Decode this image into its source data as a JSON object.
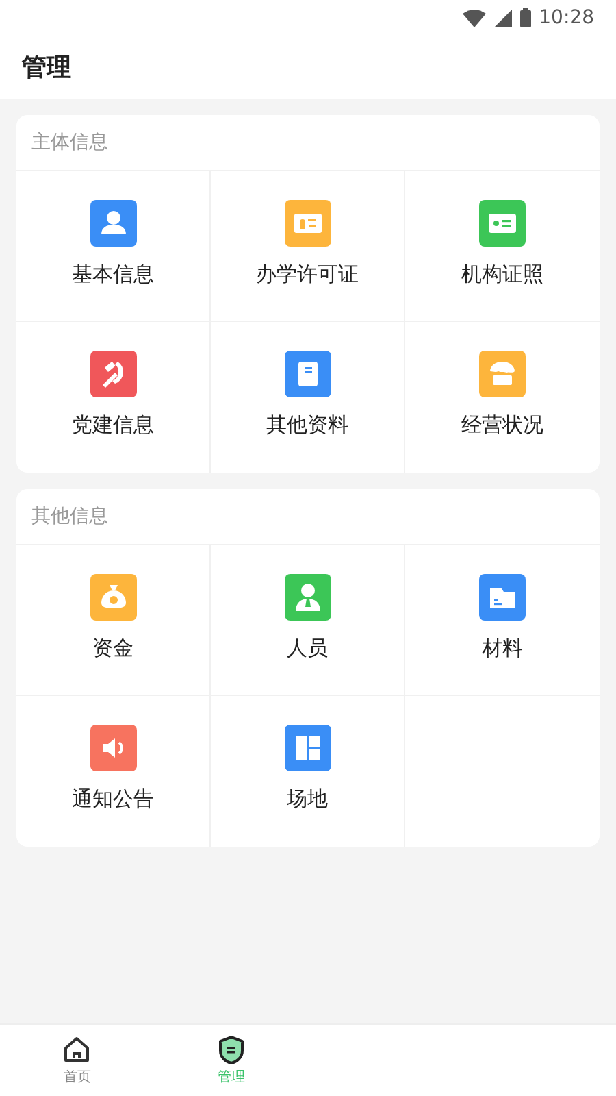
{
  "status_bar": {
    "time": "10:28"
  },
  "header": {
    "title": "管理"
  },
  "sections": [
    {
      "title": "主体信息",
      "items": [
        {
          "label": "基本信息",
          "kind": "person",
          "color": "#3a8ef6"
        },
        {
          "label": "办学许可证",
          "kind": "license",
          "color": "#fdb53c"
        },
        {
          "label": "机构证照",
          "kind": "idcard",
          "color": "#3cc657"
        },
        {
          "label": "党建信息",
          "kind": "emblem",
          "color": "#f0575a"
        },
        {
          "label": "其他资料",
          "kind": "document",
          "color": "#3a8ef6"
        },
        {
          "label": "经营状况",
          "kind": "shop",
          "color": "#fdb53c"
        }
      ]
    },
    {
      "title": "其他信息",
      "items": [
        {
          "label": "资金",
          "kind": "moneybag",
          "color": "#fdb53c"
        },
        {
          "label": "人员",
          "kind": "staff",
          "color": "#3cc657"
        },
        {
          "label": "材料",
          "kind": "folder",
          "color": "#3a8ef6"
        },
        {
          "label": "通知公告",
          "kind": "speaker",
          "color": "#f7735f"
        },
        {
          "label": "场地",
          "kind": "layout",
          "color": "#3a8ef6"
        }
      ]
    }
  ],
  "bottom_nav": [
    {
      "label": "首页",
      "kind": "home",
      "selected": false
    },
    {
      "label": "管理",
      "kind": "shield",
      "selected": true
    }
  ]
}
